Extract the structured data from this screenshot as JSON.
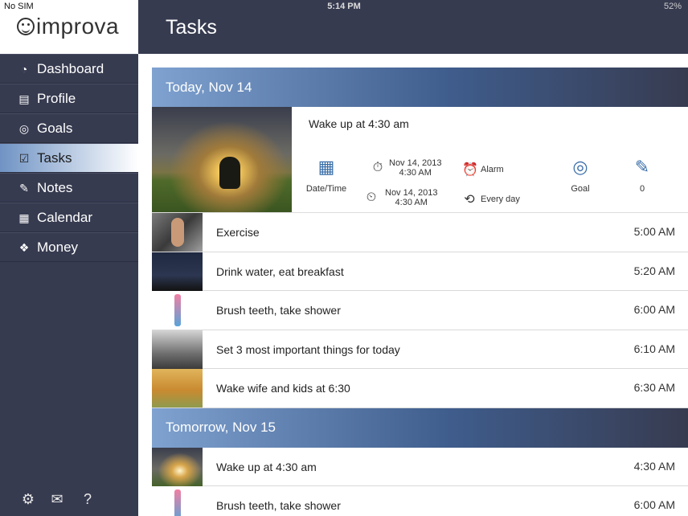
{
  "status_bar": {
    "carrier": "No SIM",
    "time": "5:14 PM",
    "battery": "52%"
  },
  "brand": {
    "name": "improva"
  },
  "header": {
    "title": "Tasks"
  },
  "sidebar": {
    "items": [
      {
        "label": "Dashboard",
        "icon": "dashboard-icon",
        "active": false
      },
      {
        "label": "Profile",
        "icon": "profile-icon",
        "active": false
      },
      {
        "label": "Goals",
        "icon": "target-icon",
        "active": false
      },
      {
        "label": "Tasks",
        "icon": "checkbox-icon",
        "active": true
      },
      {
        "label": "Notes",
        "icon": "pencil-note-icon",
        "active": false
      },
      {
        "label": "Calendar",
        "icon": "calendar-icon",
        "active": false
      },
      {
        "label": "Money",
        "icon": "money-icon",
        "active": false
      }
    ],
    "bottom": [
      "gear-icon",
      "mail-icon",
      "help-icon"
    ]
  },
  "sections": [
    {
      "title": "Today, Nov 14",
      "featured": {
        "title": "Wake up at 4:30 am",
        "datetime_label": "Date/Time",
        "start_date": "Nov 14, 2013",
        "start_time": "4:30 AM",
        "end_date": "Nov 14, 2013",
        "end_time": "4:30 AM",
        "alarm_label": "Alarm",
        "repeat_label": "Every day",
        "goal_label": "Goal",
        "notes_count": "0"
      },
      "tasks": [
        {
          "name": "Exercise",
          "time": "5:00 AM",
          "thumb": "t-gym"
        },
        {
          "name": "Drink water, eat breakfast",
          "time": "5:20 AM",
          "thumb": "t-blocks"
        },
        {
          "name": "Brush teeth, take shower",
          "time": "6:00 AM",
          "thumb": "t-tooth"
        },
        {
          "name": "Set 3 most important things for today",
          "time": "6:10 AM",
          "thumb": "t-bulbs"
        },
        {
          "name": "Wake wife and kids at 6:30",
          "time": "6:30 AM",
          "thumb": "t-family"
        }
      ]
    },
    {
      "title": "Tomorrow, Nov 15",
      "tasks": [
        {
          "name": "Wake up at 4:30 am",
          "time": "4:30 AM",
          "thumb": "t-sunrise"
        },
        {
          "name": "Brush teeth, take shower",
          "time": "6:00 AM",
          "thumb": "t-tooth"
        }
      ]
    }
  ]
}
